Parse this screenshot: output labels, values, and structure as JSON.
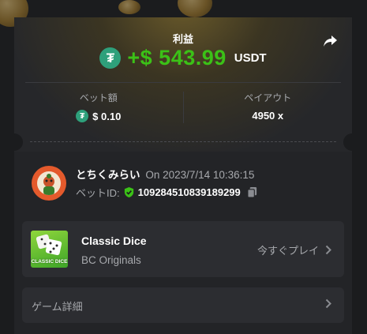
{
  "header": {
    "title": "利益",
    "amount": "+$ 543.99",
    "currency": "USDT",
    "currency_icon": "tether-icon",
    "share_icon": "share-icon"
  },
  "stats": {
    "bet_label": "ベット額",
    "bet_value": "$ 0.10",
    "payout_label": "ペイアウト",
    "payout_value": "4950 x"
  },
  "user": {
    "name": "とちくみらい",
    "on_text": "On 2023/7/14 10:36:15",
    "betid_label": "ベットID:",
    "betid_value": "109284510839189299",
    "verified_icon": "shield-check-icon",
    "copy_icon": "copy-icon"
  },
  "game": {
    "name": "Classic Dice",
    "provider": "BC Originals",
    "play_label": "今すぐプレイ",
    "thumb_text": "CLASSIC DICE"
  },
  "details": {
    "label": "ゲーム詳細"
  },
  "colors": {
    "profit_green": "#3bc117",
    "tether_green": "#2ea07b",
    "card_bg": "#232427",
    "row_bg": "#2c2d31"
  }
}
